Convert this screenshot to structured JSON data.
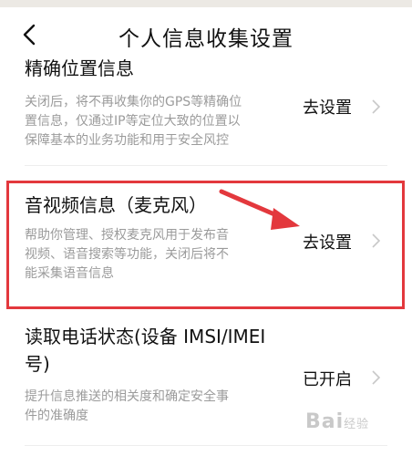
{
  "header": {
    "title": "个人信息收集设置"
  },
  "items": [
    {
      "title": "精确位置信息",
      "desc_lines": [
        "关闭后，将不再收集你的GPS等精确位",
        "置信息，仅通过IP等定位大致的位置以",
        "保障基本的业务功能和用于安全风控"
      ],
      "action": "去设置"
    },
    {
      "title": "音视频信息（麦克风）",
      "desc_lines": [
        "帮助你管理、授权麦克风用于发布音",
        "视频、语音搜索等功能，关闭后将不",
        "能采集语音信息"
      ],
      "action": "去设置"
    },
    {
      "title_lines": [
        "读取电话状态(设备 IMSI/IMEI",
        "号)"
      ],
      "desc_lines": [
        "提升信息推送的相关度和确定安全事",
        "件的准确度"
      ],
      "action": "已开启"
    }
  ],
  "watermark": {
    "main": "Bai",
    "sub": "经验"
  },
  "colors": {
    "highlight": "#e3383d",
    "desc": "#9b9b9b"
  }
}
